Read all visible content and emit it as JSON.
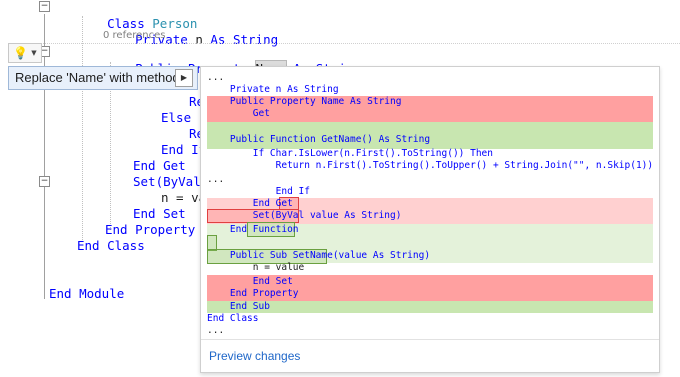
{
  "editor": {
    "lines": {
      "class_person": [
        "Class",
        "Person"
      ],
      "private_n": [
        "Private",
        "n",
        "As",
        "String"
      ],
      "references": "0 references",
      "public_property": [
        "Public",
        "Property",
        "Name",
        "As",
        "String"
      ],
      "re1": "Re",
      "else": "Else",
      "re2": "Re",
      "end_if": "End If",
      "end_get": "End Get",
      "set": "Set(ByVal",
      "n_eq": "n = va",
      "end_set": "End Set",
      "end_property": "End Property",
      "end_class": "End Class",
      "end_module": "End Module"
    }
  },
  "quick_actions": {
    "menu_item": "Replace 'Name' with methods"
  },
  "preview": {
    "lines": [
      "...",
      "    Private n As String",
      "    Public Property Name As String",
      "        Get",
      "",
      "    Public Function GetName() As String",
      "        If Char.IsLower(n.First().ToString()) Then",
      "            Return n.First().ToString().ToUpper() + String.Join(\"\", n.Skip(1))",
      "...",
      "            End If",
      "        End Get",
      "        Set(ByVal value As String)",
      "    End Function",
      "",
      "    Public Sub SetName(value As String)",
      "        n = value",
      "        End Set",
      "    End Property",
      "    End Sub",
      "End Class",
      "..."
    ],
    "preview_changes": "Preview changes"
  },
  "colors": {
    "keyword": "#0000ff",
    "type": "#2b91af",
    "deleted": "#ffa0a0",
    "added": "#c8e6b0",
    "link": "#1e66c8"
  }
}
